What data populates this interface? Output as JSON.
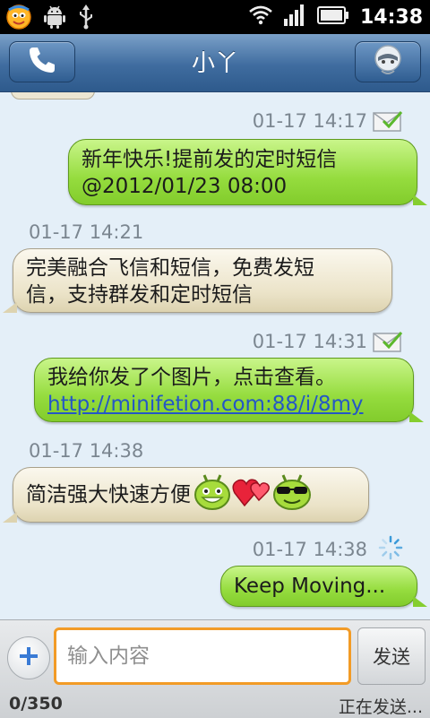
{
  "status_bar": {
    "time": "14:38",
    "icons": [
      "fetion-icon",
      "android-debug-icon",
      "usb-icon",
      "wifi-icon",
      "signal-icon",
      "battery-icon"
    ]
  },
  "header": {
    "title": "小丫",
    "left_button_icon": "phone-icon",
    "right_button_icon": "contact-avatar-icon"
  },
  "messages": [
    {
      "direction": "out",
      "time": "01-17 14:17",
      "status_icon": "delivered-check-icon",
      "lines": [
        "新年快乐!提前发的定时短信",
        "@2012/01/23 08:00"
      ]
    },
    {
      "direction": "in",
      "time": "01-17 14:21",
      "lines": [
        "完美融合飞信和短信，免费发短",
        "信，支持群发和定时短信"
      ]
    },
    {
      "direction": "out",
      "time": "01-17 14:31",
      "status_icon": "delivered-check-icon",
      "text": "我给你发了个图片，点击查看。",
      "link": "http://minifetion.com:88/i/8my"
    },
    {
      "direction": "in",
      "time": "01-17 14:38",
      "text": "简洁强大快速方便",
      "emoticons": [
        "android-smile-emoticon",
        "hearts-emoticon",
        "android-sunglasses-emoticon"
      ]
    },
    {
      "direction": "out",
      "time": "01-17 14:38",
      "status_icon": "sending-spinner-icon",
      "text": "Keep Moving..."
    }
  ],
  "compose": {
    "plus_icon": "plus-icon",
    "placeholder": "输入内容",
    "value": "",
    "send_label": "发送",
    "char_counter": "0/350",
    "status_text": "正在发送..."
  },
  "colors": {
    "outgoing_bubble": "#95dc3e",
    "incoming_bubble": "#ebe3c8",
    "header": "#3f6c9f",
    "input_focus_border": "#f29b26",
    "link": "#2457c6",
    "timestamp": "#7b8690"
  }
}
